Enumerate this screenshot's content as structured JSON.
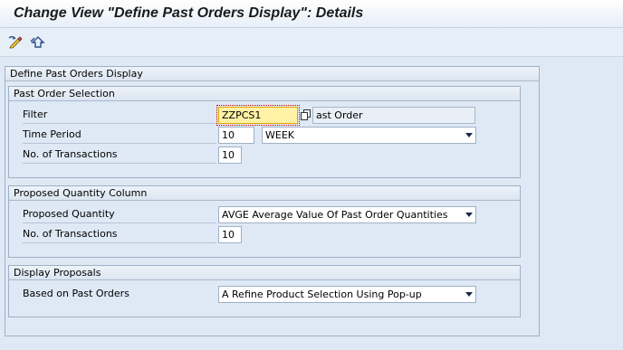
{
  "window": {
    "title": "Change View \"Define Past Orders Display\": Details"
  },
  "toolbar": {
    "icons": [
      "edit-display-icon",
      "other-object-icon"
    ]
  },
  "main_group": {
    "title": "Define Past Orders Display"
  },
  "past_order_selection": {
    "title": "Past Order Selection",
    "filter_label": "Filter",
    "filter_value": "ZZPCS1",
    "filter_description": "ast Order",
    "time_period_label": "Time Period",
    "time_period_value": "10",
    "time_period_unit": "WEEK",
    "transactions_label": "No. of Transactions",
    "transactions_value": "10"
  },
  "proposed_quantity_column": {
    "title": "Proposed Quantity Column",
    "proposed_quantity_label": "Proposed Quantity",
    "proposed_quantity_value": "AVGE Average Value Of Past Order Quantities",
    "transactions_label": "No. of Transactions",
    "transactions_value": "10"
  },
  "display_proposals": {
    "title": "Display Proposals",
    "based_on_label": "Based on Past Orders",
    "based_on_value": "A Refine Product Selection Using Pop-up"
  },
  "colors": {
    "background": "#dfe9f5",
    "focus_field": "#fff2a6",
    "group_border": "#9fb0c6"
  }
}
